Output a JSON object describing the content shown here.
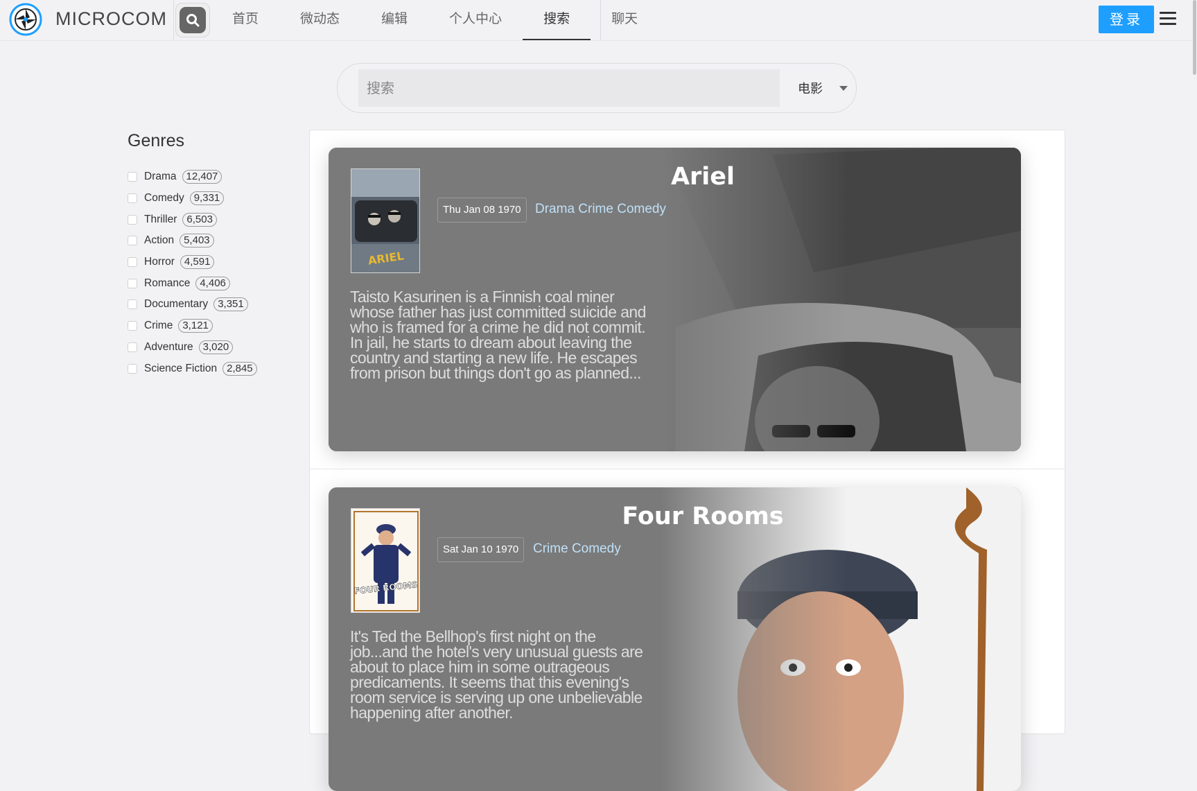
{
  "header": {
    "brand": "MICROCOM",
    "nav": [
      "首页",
      "微动态",
      "编辑",
      "个人中心",
      "搜索",
      "聊天"
    ],
    "active_nav": "搜索",
    "login_label": "登录"
  },
  "search": {
    "placeholder": "搜索",
    "category": "电影"
  },
  "sidebar": {
    "title": "Genres",
    "genres": [
      {
        "name": "Drama",
        "count": "12,407"
      },
      {
        "name": "Comedy",
        "count": "9,331"
      },
      {
        "name": "Thriller",
        "count": "6,503"
      },
      {
        "name": "Action",
        "count": "5,403"
      },
      {
        "name": "Horror",
        "count": "4,591"
      },
      {
        "name": "Romance",
        "count": "4,406"
      },
      {
        "name": "Documentary",
        "count": "3,351"
      },
      {
        "name": "Crime",
        "count": "3,121"
      },
      {
        "name": "Adventure",
        "count": "3,020"
      },
      {
        "name": "Science Fiction",
        "count": "2,845"
      }
    ]
  },
  "results": [
    {
      "title": "Ariel",
      "date": "Thu Jan 08 1970",
      "genres": "Drama Crime Comedy",
      "poster_text": "ARIEL",
      "overview": "Taisto Kasurinen is a Finnish coal miner whose father has just committed suicide and who is framed for a crime he did not commit. In jail, he starts to dream about leaving the country and starting a new life. He escapes from prison but things don't go as planned..."
    },
    {
      "title": "Four Rooms",
      "date": "Sat Jan 10 1970",
      "genres": "Crime Comedy",
      "poster_text": "FOUR ROOMS",
      "overview": "It's Ted the Bellhop's first night on the job...and the hotel's very unusual guests are about to place him in some outrageous predicaments. It seems that this evening's room service is serving up one unbelievable happening after another."
    }
  ],
  "colors": {
    "accent": "#1e9fff",
    "card_bg": "#7a7a7a",
    "genre_link": "#bfe0f7"
  }
}
